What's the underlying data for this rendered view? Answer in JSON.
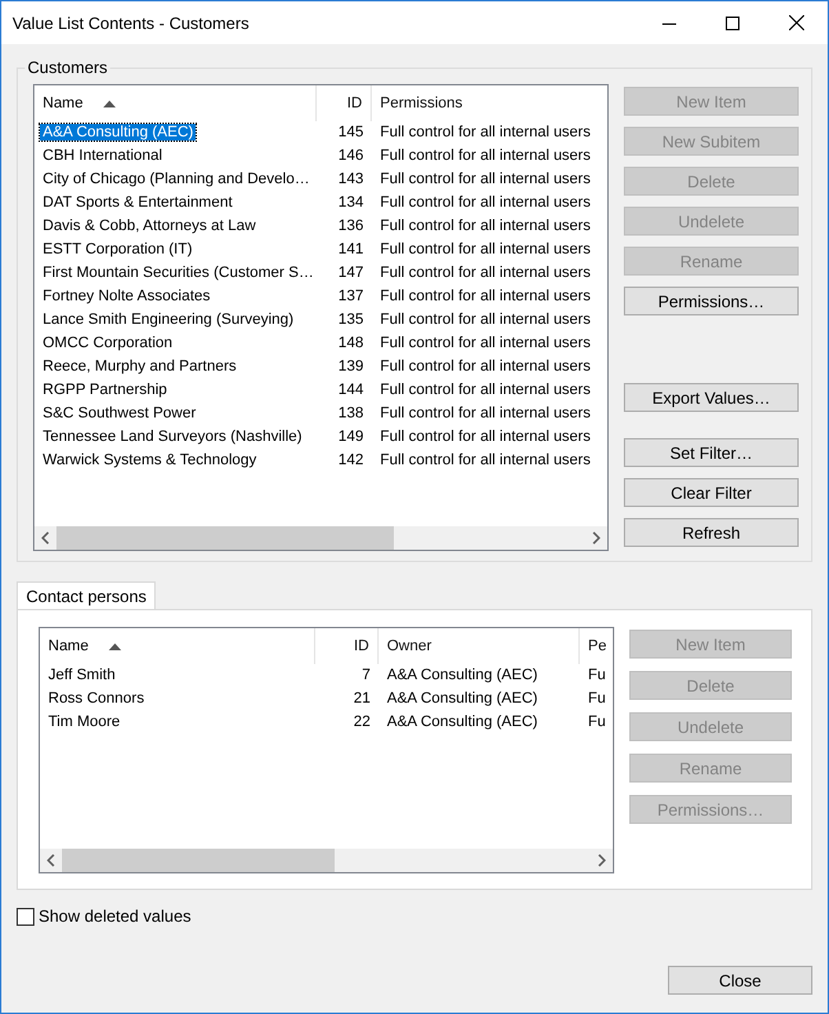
{
  "window": {
    "title": "Value List Contents - Customers"
  },
  "customers": {
    "label": "Customers",
    "columns": [
      {
        "label": "Name",
        "sorted": true
      },
      {
        "label": "ID",
        "sorted": false
      },
      {
        "label": "Permissions",
        "sorted": false
      }
    ],
    "rows": [
      {
        "name": "A&A Consulting (AEC)",
        "id": "145",
        "permissions": "Full control for all internal users",
        "selected": true
      },
      {
        "name": "CBH International",
        "id": "146",
        "permissions": "Full control for all internal users",
        "selected": false
      },
      {
        "name": "City of Chicago (Planning and Develo…",
        "id": "143",
        "permissions": "Full control for all internal users",
        "selected": false
      },
      {
        "name": "DAT Sports & Entertainment",
        "id": "134",
        "permissions": "Full control for all internal users",
        "selected": false
      },
      {
        "name": "Davis & Cobb, Attorneys at Law",
        "id": "136",
        "permissions": "Full control for all internal users",
        "selected": false
      },
      {
        "name": "ESTT Corporation (IT)",
        "id": "141",
        "permissions": "Full control for all internal users",
        "selected": false
      },
      {
        "name": "First Mountain Securities (Customer S…",
        "id": "147",
        "permissions": "Full control for all internal users",
        "selected": false
      },
      {
        "name": "Fortney Nolte Associates",
        "id": "137",
        "permissions": "Full control for all internal users",
        "selected": false
      },
      {
        "name": "Lance Smith Engineering (Surveying)",
        "id": "135",
        "permissions": "Full control for all internal users",
        "selected": false
      },
      {
        "name": "OMCC Corporation",
        "id": "148",
        "permissions": "Full control for all internal users",
        "selected": false
      },
      {
        "name": "Reece, Murphy and Partners",
        "id": "139",
        "permissions": "Full control for all internal users",
        "selected": false
      },
      {
        "name": "RGPP Partnership",
        "id": "144",
        "permissions": "Full control for all internal users",
        "selected": false
      },
      {
        "name": "S&C Southwest Power",
        "id": "138",
        "permissions": "Full control for all internal users",
        "selected": false
      },
      {
        "name": "Tennessee Land Surveyors (Nashville)",
        "id": "149",
        "permissions": "Full control for all internal users",
        "selected": false
      },
      {
        "name": "Warwick Systems & Technology",
        "id": "142",
        "permissions": "Full control for all internal users",
        "selected": false
      }
    ],
    "button_groups": [
      [
        {
          "label": "New Item",
          "disabled": true
        },
        {
          "label": "New Subitem",
          "disabled": true
        },
        {
          "label": "Delete",
          "disabled": true
        },
        {
          "label": "Undelete",
          "disabled": true
        },
        {
          "label": "Rename",
          "disabled": true
        },
        {
          "label": "Permissions…",
          "disabled": false
        }
      ],
      [
        {
          "label": "Export Values…",
          "disabled": false
        }
      ],
      [
        {
          "label": "Set Filter…",
          "disabled": false
        },
        {
          "label": "Clear Filter",
          "disabled": false
        },
        {
          "label": "Refresh",
          "disabled": false
        }
      ]
    ]
  },
  "contacts": {
    "tab": {
      "label": "Contact persons",
      "selected": true
    },
    "columns": [
      {
        "label": "Name",
        "sorted": true
      },
      {
        "label": "ID",
        "sorted": false
      },
      {
        "label": "Owner",
        "sorted": false
      },
      {
        "label": "Pe",
        "sorted": false
      }
    ],
    "rows": [
      {
        "name": "Jeff Smith",
        "id": "7",
        "owner": "A&A Consulting (AEC)",
        "column_4": "Fu"
      },
      {
        "name": "Ross Connors",
        "id": "21",
        "owner": "A&A Consulting (AEC)",
        "column_4": "Fu"
      },
      {
        "name": "Tim Moore",
        "id": "22",
        "owner": "A&A Consulting (AEC)",
        "column_4": "Fu"
      }
    ],
    "buttons": [
      {
        "label": "New Item",
        "disabled": true
      },
      {
        "label": "Delete",
        "disabled": true
      },
      {
        "label": "Undelete",
        "disabled": true
      },
      {
        "label": "Rename",
        "disabled": true
      },
      {
        "label": "Permissions…",
        "disabled": true
      }
    ]
  },
  "show_deleted": {
    "label": "Show deleted values",
    "checked": false
  },
  "close_button": {
    "label": "Close"
  }
}
